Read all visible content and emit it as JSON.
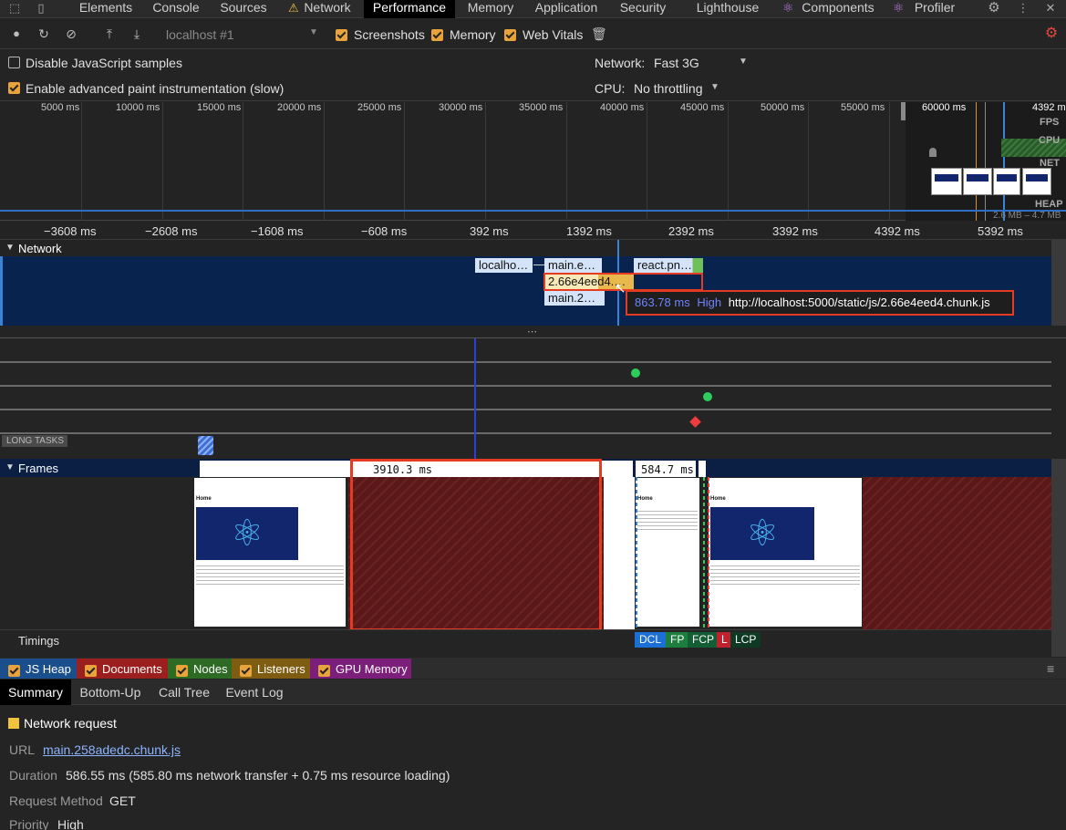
{
  "tabs": [
    "Elements",
    "Console",
    "Sources",
    "Network",
    "Performance",
    "Memory",
    "Application",
    "Security",
    "Lighthouse",
    "Components",
    "Profiler"
  ],
  "active_tab": "Performance",
  "toolbar": {
    "profile_select": "localhost #1",
    "screenshots_label": "Screenshots",
    "memory_label": "Memory",
    "web_vitals_label": "Web Vitals"
  },
  "settings": {
    "disable_js_samples": "Disable JavaScript samples",
    "advanced_paint": "Enable advanced paint instrumentation (slow)",
    "network_label": "Network:",
    "network_value": "Fast 3G",
    "cpu_label": "CPU:",
    "cpu_value": "No throttling"
  },
  "overview": {
    "ticks": [
      "5000 ms",
      "10000 ms",
      "15000 ms",
      "20000 ms",
      "25000 ms",
      "30000 ms",
      "35000 ms",
      "40000 ms",
      "45000 ms",
      "50000 ms",
      "55000 ms",
      "60000 ms"
    ],
    "right_tick": "4392 ms",
    "fps": "FPS",
    "cpu": "CPU",
    "net": "NET",
    "heap": "HEAP",
    "heap_range": "2.6 MB – 4.7 MB"
  },
  "ruler_ticks": [
    "−3608 ms",
    "−2608 ms",
    "−1608 ms",
    "−608 ms",
    "392 ms",
    "1392 ms",
    "2392 ms",
    "3392 ms",
    "4392 ms",
    "5392 ms"
  ],
  "network": {
    "title": "Network",
    "bars": [
      "localho…",
      "main.e…",
      "2.66e4eed4.…",
      "main.2…",
      "react.pn…"
    ],
    "tooltip": {
      "duration": "863.78 ms",
      "priority": "High",
      "url": "http://localhost:5000/static/js/2.66e4eed4.chunk.js"
    }
  },
  "long_tasks": "LONG TASKS",
  "frames": {
    "title": "Frames",
    "frame1": "3910.3 ms",
    "frame2": "584.7 ms",
    "shot_heading": "Home"
  },
  "timings": {
    "title": "Timings",
    "marks": [
      "DCL",
      "FP",
      "FCP",
      "L",
      "LCP"
    ]
  },
  "counters": [
    "JS Heap",
    "Documents",
    "Nodes",
    "Listeners",
    "GPU Memory"
  ],
  "bottom_tabs": [
    "Summary",
    "Bottom-Up",
    "Call Tree",
    "Event Log"
  ],
  "summary": {
    "title": "Network request",
    "url_label": "URL",
    "url_value": "main.258adedc.chunk.js",
    "duration_label": "Duration",
    "duration_value": "586.55 ms (585.80 ms network transfer + 0.75 ms resource loading)",
    "method_label": "Request Method",
    "method_value": "GET",
    "priority_label": "Priority",
    "priority_value": "High"
  }
}
